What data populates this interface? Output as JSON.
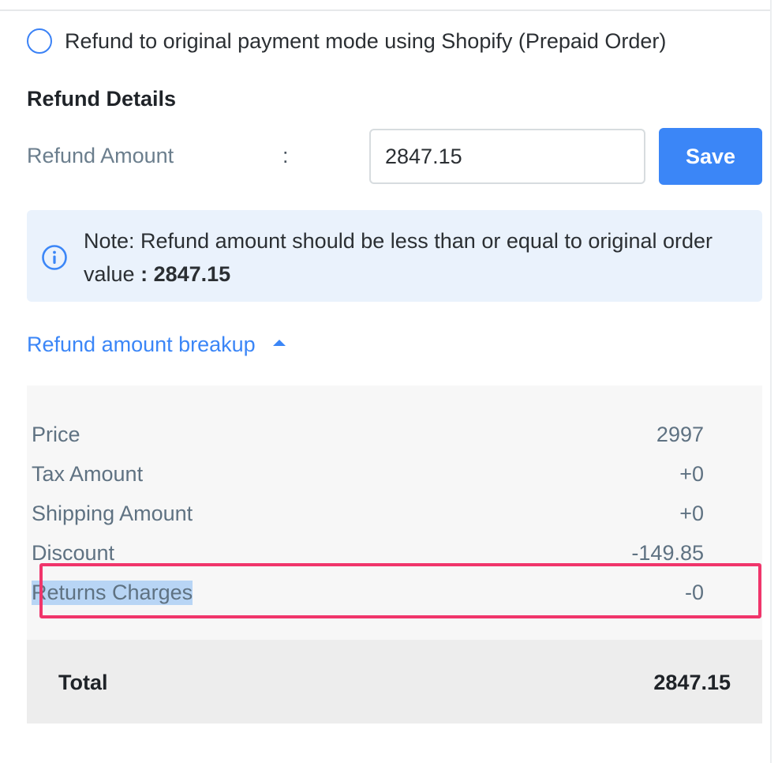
{
  "refund_mode": {
    "option_label": "Refund to original payment mode using Shopify (Prepaid Order)"
  },
  "refund_details": {
    "title": "Refund Details",
    "amount_label": "Refund Amount",
    "separator": ":",
    "amount_value": "2847.15",
    "save_label": "Save"
  },
  "note": {
    "icon": "info-icon",
    "text": "Note: Refund amount should be less than or equal to original order value",
    "value_prefix": ": ",
    "value": "2847.15"
  },
  "breakup": {
    "toggle_label": "Refund amount breakup",
    "toggle_icon": "caret-up-icon",
    "rows": [
      {
        "label": "Price",
        "value": "2997"
      },
      {
        "label": "Tax Amount",
        "value": "+0"
      },
      {
        "label": "Shipping Amount",
        "value": "+0"
      },
      {
        "label": "Discount",
        "value": "-149.85"
      },
      {
        "label": "Returns Charges",
        "value": "-0"
      }
    ],
    "total_label": "Total",
    "total_value": "2847.15"
  },
  "colors": {
    "accent": "#3b86f7",
    "note_background": "#eaf2fc",
    "highlight_border": "#f0356b",
    "selection": "#b8d5f5"
  }
}
